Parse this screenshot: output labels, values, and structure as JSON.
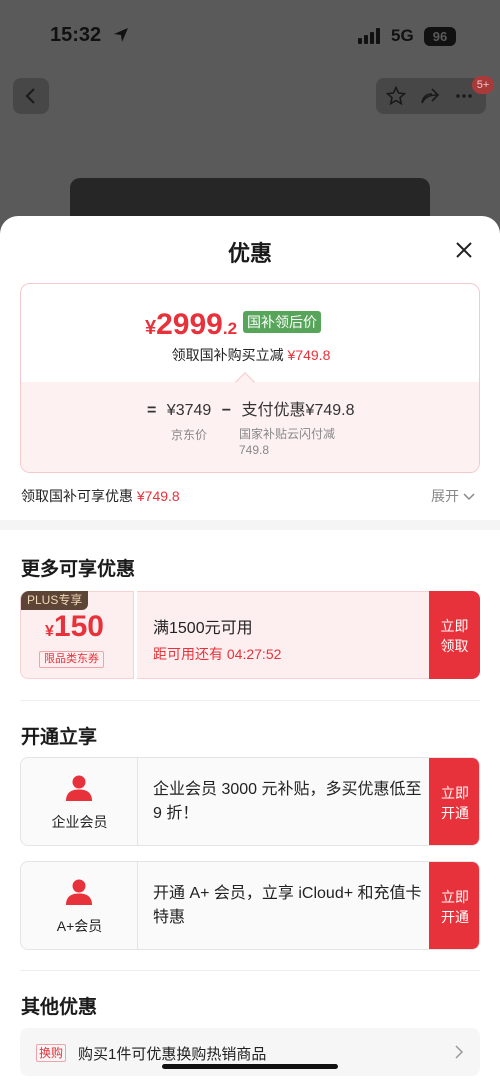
{
  "status": {
    "time": "15:32",
    "network": "5G",
    "battery": "96"
  },
  "nav": {
    "badge": "5+"
  },
  "sheet": {
    "title": "优惠",
    "price_card": {
      "currency": "¥",
      "price_int": "2999",
      "price_dec": ".2",
      "tag": "国补领后价",
      "sub_label": "领取国补购买立减",
      "sub_value": "¥749.8",
      "eq": "=",
      "jd_price": "¥3749",
      "minus": "−",
      "pay_discount": "支付优惠¥749.8",
      "jd_caption": "京东价",
      "subsidy_caption": "国家补贴云闪付减749.8"
    },
    "guobu": {
      "label": "领取国补可享优惠",
      "value": "¥749.8",
      "expand": "展开"
    },
    "more": {
      "title": "更多可享优惠",
      "coupon": {
        "tag": "PLUS专享",
        "currency": "¥",
        "amount": "150",
        "scope": "限品类东券",
        "condition": "满1500元可用",
        "countdown": "距可用还有 04:27:52",
        "button_l1": "立即",
        "button_l2": "领取"
      }
    },
    "open": {
      "title": "开通立享",
      "members": [
        {
          "name": "企业会员",
          "desc": "企业会员 3000 元补贴，多买优惠低至 9 折！",
          "btn_l1": "立即",
          "btn_l2": "开通"
        },
        {
          "name": "A+会员",
          "desc": "开通 A+ 会员，立享 iCloud+ 和充值卡特惠",
          "btn_l1": "立即",
          "btn_l2": "开通"
        }
      ]
    },
    "other": {
      "title": "其他优惠",
      "row": {
        "tag": "换购",
        "text": "购买1件可优惠换购热销商品"
      }
    }
  },
  "colors": {
    "accent": "#e8323b",
    "green_tag": "#57a55a",
    "plus_tag": "#5c4437"
  }
}
